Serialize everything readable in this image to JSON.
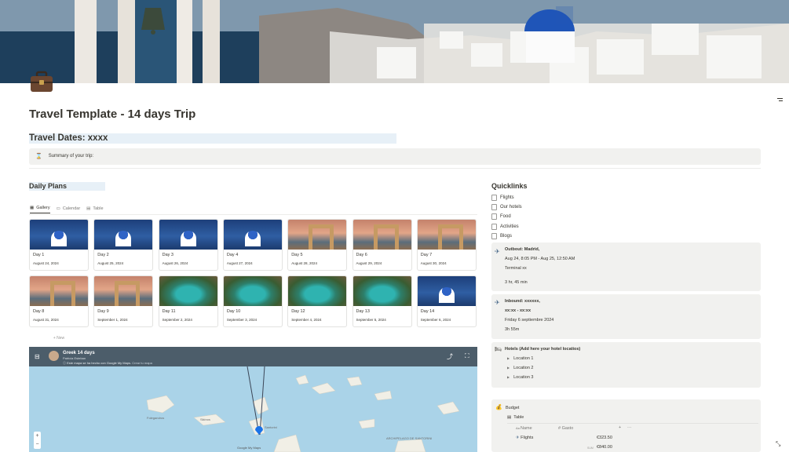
{
  "page": {
    "title": "Travel Template - 14 days Trip",
    "icon": "briefcase-icon",
    "travel_dates": "Travel Dates: xxxx",
    "callout_icon": "hourglass-icon",
    "callout_text": "Summary of your trip:"
  },
  "daily_plans": {
    "title": "Daily Plans",
    "tabs": [
      {
        "label": "Gallery",
        "icon": "gallery-icon"
      },
      {
        "label": "Calendar",
        "icon": "calendar-icon"
      },
      {
        "label": "Table",
        "icon": "table-icon"
      }
    ],
    "cards": [
      {
        "title": "Day 1",
        "date": "August 24, 2024",
        "image": "oia"
      },
      {
        "title": "Day 2",
        "date": "August 25, 2024",
        "image": "oia"
      },
      {
        "title": "Day 3",
        "date": "August 26, 2024",
        "image": "oia"
      },
      {
        "title": "Day 4",
        "date": "August 27, 2024",
        "image": "oia"
      },
      {
        "title": "Day 5",
        "date": "August 28, 2024",
        "image": "naxos"
      },
      {
        "title": "Day 6",
        "date": "August 29, 2024",
        "image": "naxos"
      },
      {
        "title": "Day 7",
        "date": "August 30, 2024",
        "image": "naxos"
      },
      {
        "title": "Day 8",
        "date": "August 31, 2024",
        "image": "naxos"
      },
      {
        "title": "Day 9",
        "date": "September 1, 2024",
        "image": "naxos"
      },
      {
        "title": "Day 11",
        "date": "September 2, 2024",
        "image": "bay"
      },
      {
        "title": "Day 10",
        "date": "September 3, 2024",
        "image": "bay"
      },
      {
        "title": "Day 12",
        "date": "September 4, 2024",
        "image": "bay"
      },
      {
        "title": "Day 13",
        "date": "September 5, 2024",
        "image": "bay"
      },
      {
        "title": "Day 14",
        "date": "September 6, 2024",
        "image": "oia"
      }
    ],
    "new_label": "+ New"
  },
  "map": {
    "title": "Greek 14 days",
    "author": "Patricia Esteban",
    "note": "Este mapa se ha hecho con Google My Maps.",
    "note_link": "Crear tu mapa",
    "island_labels": [
      "Folegandros",
      "Sikinos",
      "Santorini",
      "ARCHIPELAGO DE SANTORINI"
    ],
    "footer": "Google My Maps",
    "zoom_in": "+",
    "zoom_out": "−"
  },
  "quicklinks": {
    "title": "Quicklinks",
    "items": [
      "Flights",
      "Our hotels",
      "Food",
      "Activities",
      "Blogs"
    ]
  },
  "outbound": {
    "title": "Outbout: Madrid,",
    "datetime": "Aug 24, 8:05 PM  - Aug 25, 12:50 AM",
    "terminal": "Terminal xx",
    "duration": "3 hr, 45 min"
  },
  "inbound": {
    "title": "Inbound: xxxxxx,",
    "route": "xx:xx - xx:xx",
    "date": "Friday 6 septiembre 2024",
    "duration": "3h 55m"
  },
  "hotels": {
    "title": "Hotels (Add here your hotel locatios)",
    "items": [
      "Location 1",
      "Location 2",
      "Location 3"
    ]
  },
  "budget": {
    "title": "Budget",
    "view": "Table",
    "col_name": "Name",
    "col_gasto": "Gasto",
    "row_name": "Flights",
    "row_value": "€323.50",
    "sum_label": "SUM",
    "sum_value": "€840.00"
  }
}
